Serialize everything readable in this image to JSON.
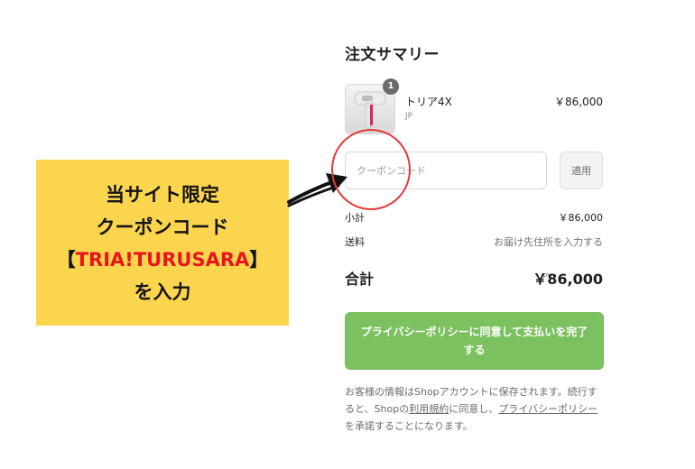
{
  "summary": {
    "title": "注文サマリー"
  },
  "product": {
    "quantity": "1",
    "name": "トリア4X",
    "variant": "JP",
    "price": "￥86,000",
    "icon": "product-thumbnail"
  },
  "coupon": {
    "placeholder": "クーポンコード",
    "apply_label": "適用"
  },
  "totals": {
    "subtotal_label": "小計",
    "subtotal_value": "￥86,000",
    "shipping_label": "送料",
    "shipping_value": "お届け先住所を入力する",
    "total_label": "合計",
    "total_currency": "JPY",
    "total_value": "￥86,000"
  },
  "pay_button": {
    "label": "プライバシーポリシーに同意して支払いを完了する"
  },
  "notice": {
    "part1": "お客様の情報はShopアカウントに保存されます。続行すると、Shopの",
    "terms_link": "利用規約",
    "part2": "に同意し、",
    "privacy_link": "プライバシーポリシー",
    "part3": "を承諾することになります。"
  },
  "banner": {
    "line1": "当サイト限定",
    "line2": "クーポンコード",
    "bracket_open": "【",
    "code": "TRIA!TURUSARA",
    "bracket_close": "】",
    "line4": "を入力"
  },
  "colors": {
    "banner_bg": "#fcd54e",
    "code_red": "#e8151c",
    "highlight_circle": "#e23a3a",
    "pay_button_green": "#7cc160"
  }
}
